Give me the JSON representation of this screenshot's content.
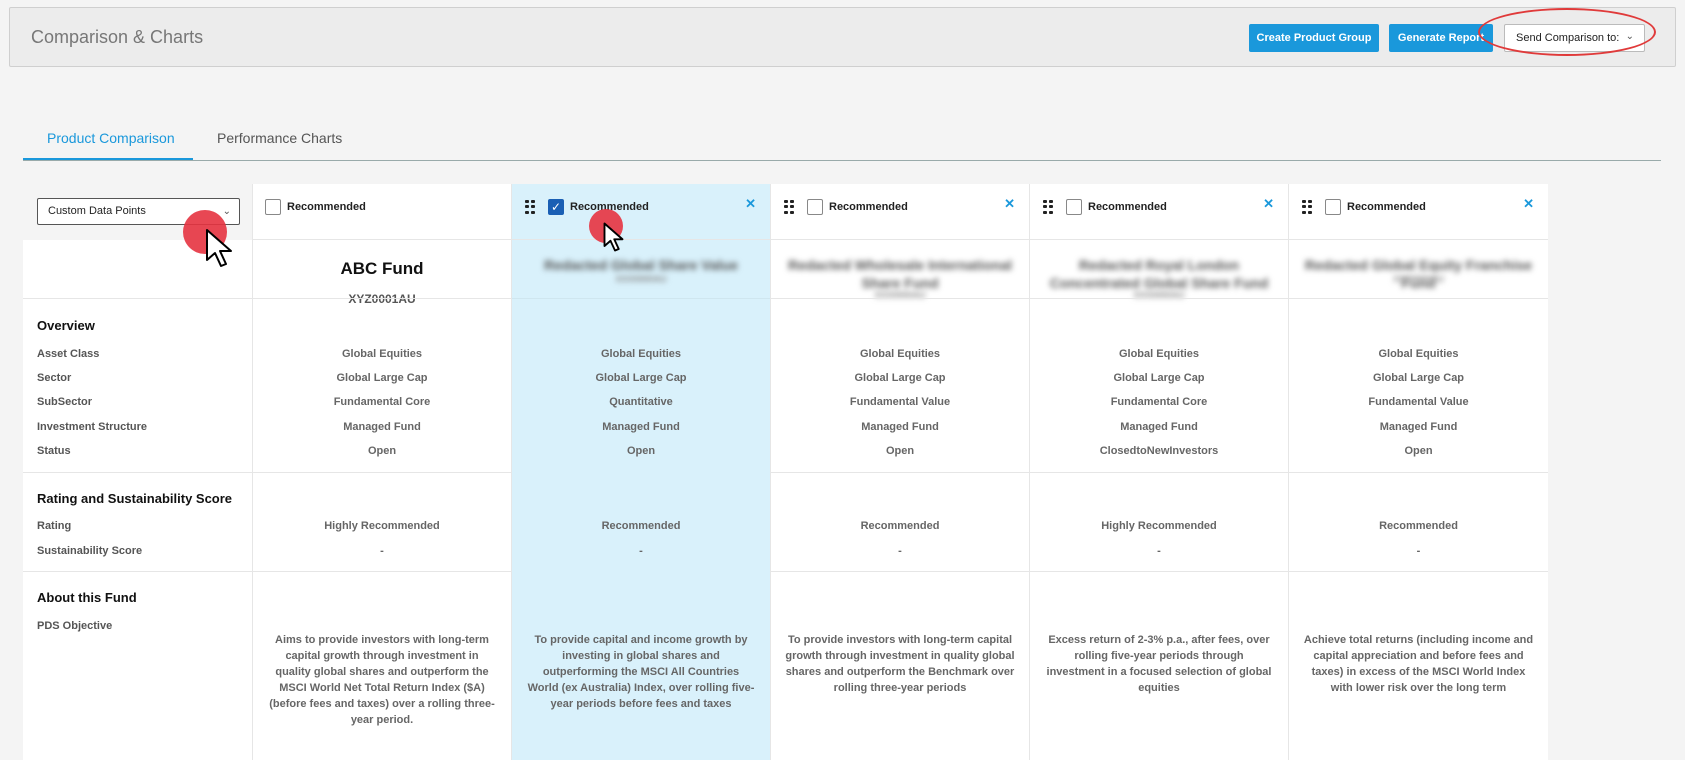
{
  "header": {
    "title": "Comparison & Charts",
    "create_group_label": "Create Product Group",
    "generate_report_label": "Generate Report",
    "send_comparison_label": "Send Comparison to:"
  },
  "tabs": [
    {
      "label": "Product Comparison",
      "active": true
    },
    {
      "label": "Performance Charts",
      "active": false
    }
  ],
  "data_points_select": "Custom Data Points",
  "sections": {
    "overview": "Overview",
    "rating": "Rating and Sustainability Score",
    "about": "About this Fund"
  },
  "row_labels": {
    "asset_class": "Asset Class",
    "sector": "Sector",
    "subsector": "SubSector",
    "investment_structure": "Investment Structure",
    "status": "Status",
    "rating": "Rating",
    "sustainability": "Sustainability Score",
    "pds_objective": "PDS Objective"
  },
  "funds": [
    {
      "recommended_label": "Recommended",
      "checked": false,
      "name": "ABC Fund",
      "code": "XYZ0001AU",
      "asset_class": "Global Equities",
      "sector": "Global Large Cap",
      "subsector": "Fundamental Core",
      "investment_structure": "Managed Fund",
      "status": "Open",
      "rating": "Highly Recommended",
      "sustainability": "-",
      "objective": "Aims to provide investors with long-term capital growth through investment in quality global shares and outperform the MSCI World Net Total Return Index ($A) (before fees and taxes) over a rolling three-year period."
    },
    {
      "recommended_label": "Recommended",
      "checked": true,
      "name": "Redacted Global Share Value",
      "code": "XXX0000AU",
      "asset_class": "Global Equities",
      "sector": "Global Large Cap",
      "subsector": "Quantitative",
      "investment_structure": "Managed Fund",
      "status": "Open",
      "rating": "Recommended",
      "sustainability": "-",
      "objective": "To provide capital and income growth by investing in global shares and outperforming the MSCI All Countries World (ex Australia) Index, over rolling five-year periods before fees and taxes"
    },
    {
      "recommended_label": "Recommended",
      "checked": false,
      "name": "Redacted Wholesale International Share Fund",
      "code": "XXX0000AU",
      "asset_class": "Global Equities",
      "sector": "Global Large Cap",
      "subsector": "Fundamental Value",
      "investment_structure": "Managed Fund",
      "status": "Open",
      "rating": "Recommended",
      "sustainability": "-",
      "objective": "To provide investors with long-term capital growth through investment in quality global shares and outperform the Benchmark over rolling three-year periods"
    },
    {
      "recommended_label": "Recommended",
      "checked": false,
      "name": "Redacted Royal London Concentrated Global Share Fund",
      "code": "XXX0000AU",
      "asset_class": "Global Equities",
      "sector": "Global Large Cap",
      "subsector": "Fundamental Core",
      "investment_structure": "Managed Fund",
      "status": "ClosedtoNewInvestors",
      "rating": "Highly Recommended",
      "sustainability": "-",
      "objective": "Excess return of 2-3% p.a., after fees, over rolling five-year periods through investment in a focused selection of global equities"
    },
    {
      "recommended_label": "Recommended",
      "checked": false,
      "name": "Redacted Global Equity Franchise Fund",
      "code": "XXX0000AU",
      "asset_class": "Global Equities",
      "sector": "Global Large Cap",
      "subsector": "Fundamental Value",
      "investment_structure": "Managed Fund",
      "status": "Open",
      "rating": "Recommended",
      "sustainability": "-",
      "objective": "Achieve total returns (including income and capital appreciation and before fees and taxes) in excess of the MSCI World Index with lower risk over the long term"
    }
  ],
  "colors": {
    "accent": "#1a98db",
    "highlight": "#d9f1fb",
    "annotation": "#e03a3a"
  }
}
